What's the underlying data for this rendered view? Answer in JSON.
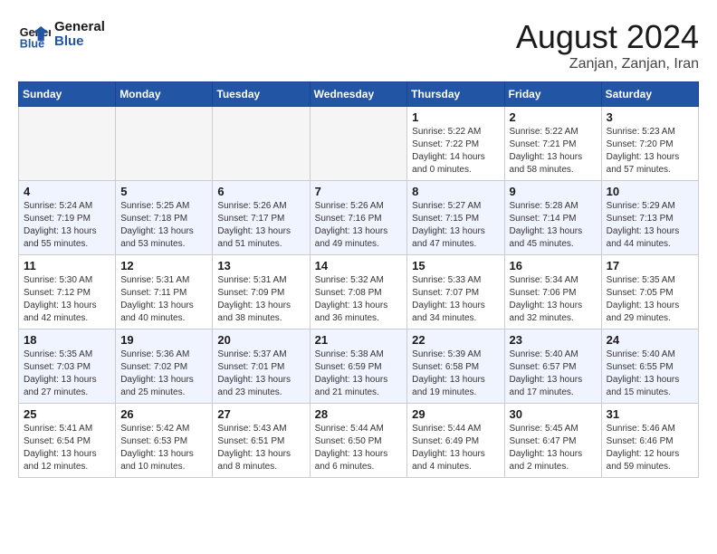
{
  "header": {
    "logo_line1": "General",
    "logo_line2": "Blue",
    "month_year": "August 2024",
    "location": "Zanjan, Zanjan, Iran"
  },
  "weekdays": [
    "Sunday",
    "Monday",
    "Tuesday",
    "Wednesday",
    "Thursday",
    "Friday",
    "Saturday"
  ],
  "weeks": [
    [
      {
        "day": "",
        "info": ""
      },
      {
        "day": "",
        "info": ""
      },
      {
        "day": "",
        "info": ""
      },
      {
        "day": "",
        "info": ""
      },
      {
        "day": "1",
        "info": "Sunrise: 5:22 AM\nSunset: 7:22 PM\nDaylight: 14 hours\nand 0 minutes."
      },
      {
        "day": "2",
        "info": "Sunrise: 5:22 AM\nSunset: 7:21 PM\nDaylight: 13 hours\nand 58 minutes."
      },
      {
        "day": "3",
        "info": "Sunrise: 5:23 AM\nSunset: 7:20 PM\nDaylight: 13 hours\nand 57 minutes."
      }
    ],
    [
      {
        "day": "4",
        "info": "Sunrise: 5:24 AM\nSunset: 7:19 PM\nDaylight: 13 hours\nand 55 minutes."
      },
      {
        "day": "5",
        "info": "Sunrise: 5:25 AM\nSunset: 7:18 PM\nDaylight: 13 hours\nand 53 minutes."
      },
      {
        "day": "6",
        "info": "Sunrise: 5:26 AM\nSunset: 7:17 PM\nDaylight: 13 hours\nand 51 minutes."
      },
      {
        "day": "7",
        "info": "Sunrise: 5:26 AM\nSunset: 7:16 PM\nDaylight: 13 hours\nand 49 minutes."
      },
      {
        "day": "8",
        "info": "Sunrise: 5:27 AM\nSunset: 7:15 PM\nDaylight: 13 hours\nand 47 minutes."
      },
      {
        "day": "9",
        "info": "Sunrise: 5:28 AM\nSunset: 7:14 PM\nDaylight: 13 hours\nand 45 minutes."
      },
      {
        "day": "10",
        "info": "Sunrise: 5:29 AM\nSunset: 7:13 PM\nDaylight: 13 hours\nand 44 minutes."
      }
    ],
    [
      {
        "day": "11",
        "info": "Sunrise: 5:30 AM\nSunset: 7:12 PM\nDaylight: 13 hours\nand 42 minutes."
      },
      {
        "day": "12",
        "info": "Sunrise: 5:31 AM\nSunset: 7:11 PM\nDaylight: 13 hours\nand 40 minutes."
      },
      {
        "day": "13",
        "info": "Sunrise: 5:31 AM\nSunset: 7:09 PM\nDaylight: 13 hours\nand 38 minutes."
      },
      {
        "day": "14",
        "info": "Sunrise: 5:32 AM\nSunset: 7:08 PM\nDaylight: 13 hours\nand 36 minutes."
      },
      {
        "day": "15",
        "info": "Sunrise: 5:33 AM\nSunset: 7:07 PM\nDaylight: 13 hours\nand 34 minutes."
      },
      {
        "day": "16",
        "info": "Sunrise: 5:34 AM\nSunset: 7:06 PM\nDaylight: 13 hours\nand 32 minutes."
      },
      {
        "day": "17",
        "info": "Sunrise: 5:35 AM\nSunset: 7:05 PM\nDaylight: 13 hours\nand 29 minutes."
      }
    ],
    [
      {
        "day": "18",
        "info": "Sunrise: 5:35 AM\nSunset: 7:03 PM\nDaylight: 13 hours\nand 27 minutes."
      },
      {
        "day": "19",
        "info": "Sunrise: 5:36 AM\nSunset: 7:02 PM\nDaylight: 13 hours\nand 25 minutes."
      },
      {
        "day": "20",
        "info": "Sunrise: 5:37 AM\nSunset: 7:01 PM\nDaylight: 13 hours\nand 23 minutes."
      },
      {
        "day": "21",
        "info": "Sunrise: 5:38 AM\nSunset: 6:59 PM\nDaylight: 13 hours\nand 21 minutes."
      },
      {
        "day": "22",
        "info": "Sunrise: 5:39 AM\nSunset: 6:58 PM\nDaylight: 13 hours\nand 19 minutes."
      },
      {
        "day": "23",
        "info": "Sunrise: 5:40 AM\nSunset: 6:57 PM\nDaylight: 13 hours\nand 17 minutes."
      },
      {
        "day": "24",
        "info": "Sunrise: 5:40 AM\nSunset: 6:55 PM\nDaylight: 13 hours\nand 15 minutes."
      }
    ],
    [
      {
        "day": "25",
        "info": "Sunrise: 5:41 AM\nSunset: 6:54 PM\nDaylight: 13 hours\nand 12 minutes."
      },
      {
        "day": "26",
        "info": "Sunrise: 5:42 AM\nSunset: 6:53 PM\nDaylight: 13 hours\nand 10 minutes."
      },
      {
        "day": "27",
        "info": "Sunrise: 5:43 AM\nSunset: 6:51 PM\nDaylight: 13 hours\nand 8 minutes."
      },
      {
        "day": "28",
        "info": "Sunrise: 5:44 AM\nSunset: 6:50 PM\nDaylight: 13 hours\nand 6 minutes."
      },
      {
        "day": "29",
        "info": "Sunrise: 5:44 AM\nSunset: 6:49 PM\nDaylight: 13 hours\nand 4 minutes."
      },
      {
        "day": "30",
        "info": "Sunrise: 5:45 AM\nSunset: 6:47 PM\nDaylight: 13 hours\nand 2 minutes."
      },
      {
        "day": "31",
        "info": "Sunrise: 5:46 AM\nSunset: 6:46 PM\nDaylight: 12 hours\nand 59 minutes."
      }
    ]
  ]
}
